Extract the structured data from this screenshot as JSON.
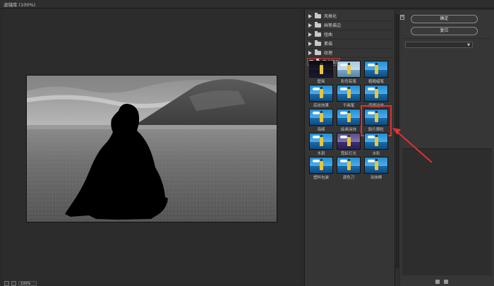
{
  "window": {
    "title": "滤镜库 (100%)"
  },
  "status": {
    "zoom": "100%"
  },
  "categories": [
    {
      "label": "风格化",
      "expanded": false
    },
    {
      "label": "画笔描边",
      "expanded": false
    },
    {
      "label": "扭曲",
      "expanded": false
    },
    {
      "label": "素描",
      "expanded": false
    },
    {
      "label": "纹理",
      "expanded": false
    },
    {
      "label": "艺术效果",
      "expanded": true
    }
  ],
  "filters": [
    {
      "label": "壁画",
      "style": "dark"
    },
    {
      "label": "彩色铅笔",
      "style": "pale"
    },
    {
      "label": "粗糙蜡笔",
      "style": "normal"
    },
    {
      "label": "底纹效果",
      "style": "normal"
    },
    {
      "label": "干画笔",
      "style": "normal"
    },
    {
      "label": "海报边缘",
      "style": "normal"
    },
    {
      "label": "海绵",
      "style": "normal"
    },
    {
      "label": "绘画涂抹",
      "style": "normal"
    },
    {
      "label": "胶片颗粒",
      "style": "normal",
      "selected": true
    },
    {
      "label": "木刻",
      "style": "normal"
    },
    {
      "label": "霓虹灯光",
      "style": "purple"
    },
    {
      "label": "水彩",
      "style": "normal"
    },
    {
      "label": "塑料包装",
      "style": "normal"
    },
    {
      "label": "调色刀",
      "style": "normal"
    },
    {
      "label": "涂抹棒",
      "style": "normal"
    }
  ],
  "right_panel": {
    "ok_label": "确定",
    "reset_label": "复位",
    "dropdown_value": ""
  },
  "annotation": {
    "color": "#e23030"
  }
}
